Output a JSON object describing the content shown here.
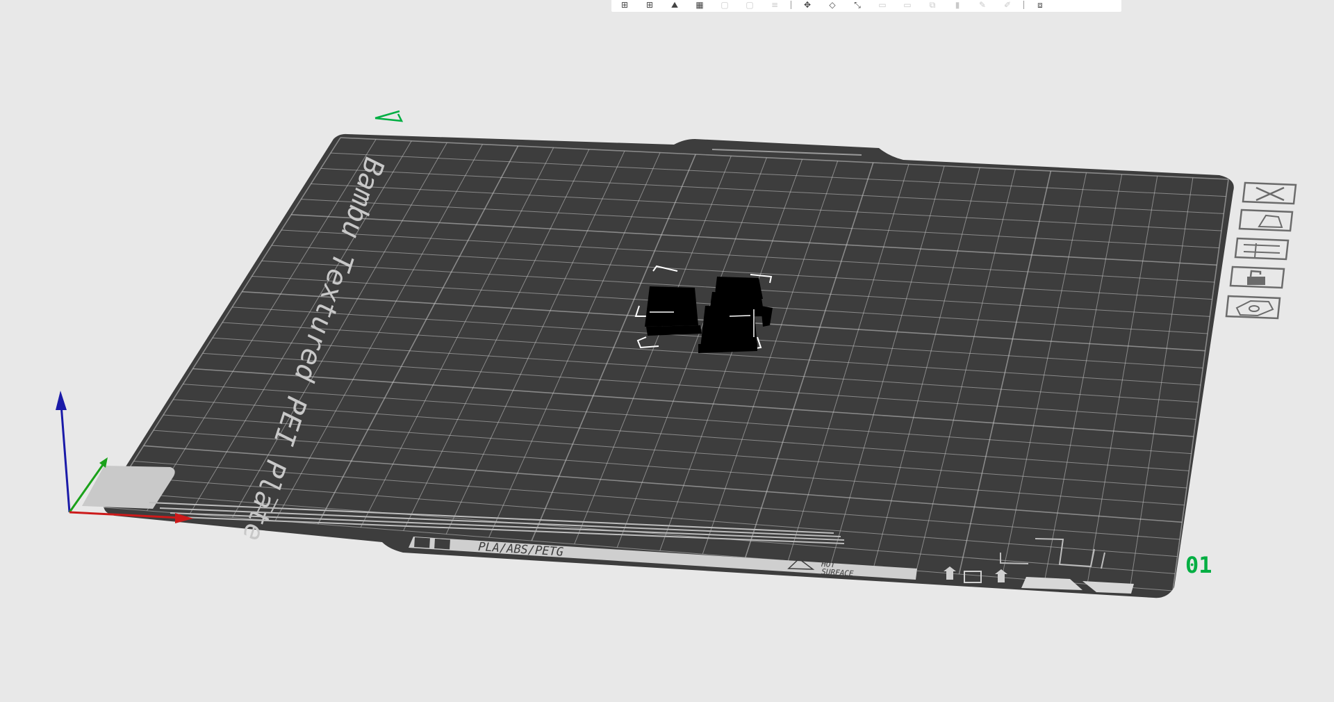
{
  "app": {
    "view": "3D Prepare view"
  },
  "toolbar": {
    "buttons": [
      {
        "name": "add-object-button",
        "glyph": "⊞",
        "enabled": true
      },
      {
        "name": "add-plate-button",
        "glyph": "⊞",
        "enabled": true
      },
      {
        "name": "auto-orient-button",
        "glyph": "⛰",
        "enabled": true
      },
      {
        "name": "arrange-button",
        "glyph": "▦",
        "enabled": true
      },
      {
        "name": "split-objects-button",
        "glyph": "▢",
        "enabled": false
      },
      {
        "name": "split-parts-button",
        "glyph": "▢",
        "enabled": false
      },
      {
        "name": "layers-button",
        "glyph": "≡",
        "enabled": false
      },
      {
        "name": "move-tool-button",
        "glyph": "✥",
        "enabled": true
      },
      {
        "name": "rotate-tool-button",
        "glyph": "◇",
        "enabled": true
      },
      {
        "name": "scale-tool-button",
        "glyph": "⤡",
        "enabled": true
      },
      {
        "name": "lay-on-face-button",
        "glyph": "▭",
        "enabled": false
      },
      {
        "name": "cut-tool-button",
        "glyph": "▭",
        "enabled": false
      },
      {
        "name": "mesh-boolean-button",
        "glyph": "⧉",
        "enabled": false
      },
      {
        "name": "support-paint-button",
        "glyph": "▮",
        "enabled": false
      },
      {
        "name": "seam-paint-button",
        "glyph": "✎",
        "enabled": false
      },
      {
        "name": "color-paint-button",
        "glyph": "✐",
        "enabled": false
      },
      {
        "name": "measure-button",
        "glyph": "⟋",
        "enabled": false
      },
      {
        "name": "assembly-view-button",
        "glyph": "⧈",
        "enabled": true
      }
    ]
  },
  "plate": {
    "name_text": "Bambu Textured PEI Plate",
    "filament_text": "PLA/ABS/PETG",
    "hot_surface_line1": "HOT",
    "hot_surface_line2": "SURFACE",
    "plate_number": "01",
    "plate_color": "#3d3d3d",
    "grid_color": "#c8c8c8",
    "number_color": "#00ae42"
  },
  "plate_buttons": [
    {
      "name": "delete-plate-button",
      "icon": "close-icon"
    },
    {
      "name": "auto-arrange-plate-button",
      "icon": "arrange-icon"
    },
    {
      "name": "plate-settings-button",
      "icon": "layout-icon"
    },
    {
      "name": "lock-plate-button",
      "icon": "lock-icon"
    },
    {
      "name": "plate-visibility-button",
      "icon": "eye-icon"
    }
  ],
  "axes": {
    "x_color": "#cc1a1a",
    "y_color": "#1aa11a",
    "z_color": "#1a1aa8"
  },
  "objects": {
    "count": 4,
    "color": "#000000"
  }
}
